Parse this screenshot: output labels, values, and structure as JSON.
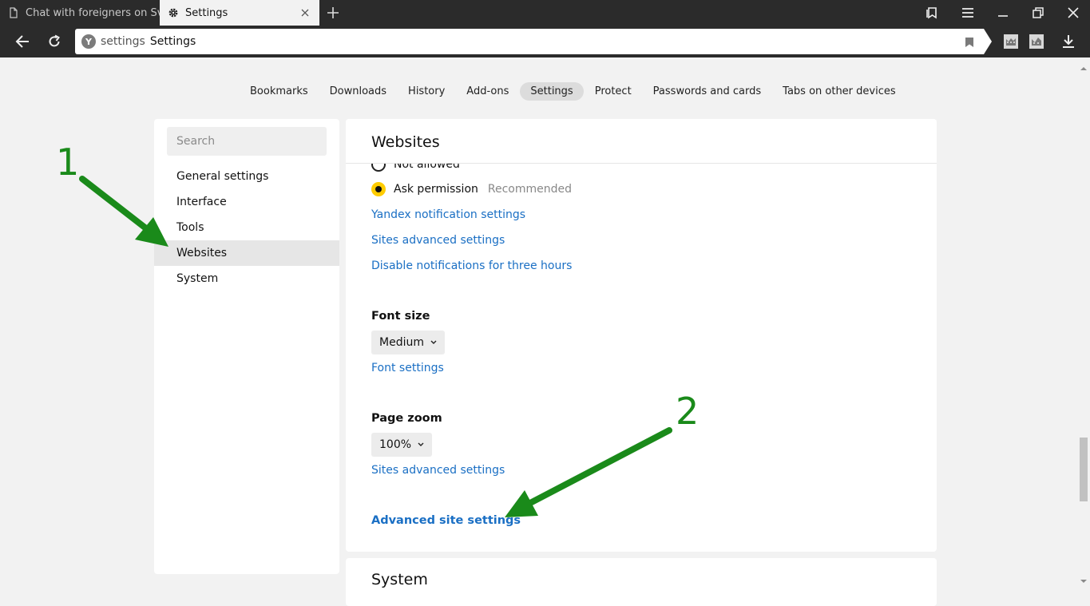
{
  "tabs": [
    {
      "title": "Chat with foreigners on Svapa",
      "active": false,
      "icon": "page-icon"
    },
    {
      "title": "Settings",
      "active": true,
      "icon": "gear-icon"
    }
  ],
  "omnibox": {
    "scheme": "settings",
    "title": "Settings"
  },
  "topnav": {
    "items": [
      "Bookmarks",
      "Downloads",
      "History",
      "Add-ons",
      "Settings",
      "Protect",
      "Passwords and cards",
      "Tabs on other devices"
    ],
    "active": "Settings"
  },
  "sidebar": {
    "search_placeholder": "Search",
    "items": [
      "General settings",
      "Interface",
      "Tools",
      "Websites",
      "System"
    ],
    "active": "Websites"
  },
  "main": {
    "title": "Websites",
    "radio_not_allowed": "Not allowed",
    "radio_ask": "Ask permission",
    "radio_ask_hint": "Recommended",
    "links": [
      "Yandex notification settings",
      "Sites advanced settings",
      "Disable notifications for three hours"
    ],
    "font_size_label": "Font size",
    "font_size_value": "Medium",
    "font_settings_link": "Font settings",
    "page_zoom_label": "Page zoom",
    "page_zoom_value": "100%",
    "zoom_sites_link": "Sites advanced settings",
    "advanced_link": "Advanced site settings",
    "next_section_title": "System"
  },
  "annotations": {
    "one": "1",
    "two": "2",
    "color": "#1a8a1a"
  }
}
